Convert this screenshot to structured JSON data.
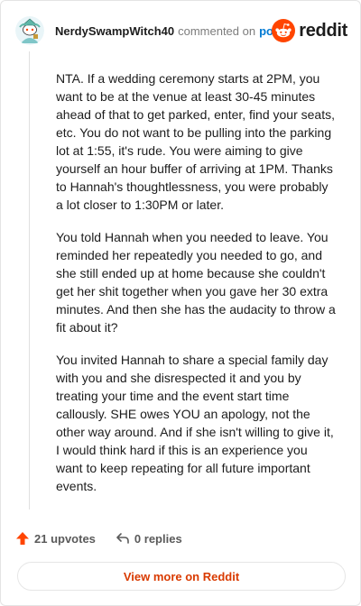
{
  "header": {
    "username": "NerdySwampWitch40",
    "action_text": "commented on",
    "post_link": "post",
    "brand": "reddit"
  },
  "comment": {
    "paragraphs": [
      "NTA. If a wedding ceremony starts at 2PM, you want to be at the venue at least 30-45 minutes ahead of that to get parked, enter, find your seats, etc. You do not want to be pulling into the parking lot at 1:55, it's rude. You were aiming to give yourself an hour buffer of arriving at 1PM. Thanks to Hannah's thoughtlessness, you were probably a lot closer to 1:30PM or later.",
      "You told Hannah when you needed to leave. You reminded her repeatedly you needed to go, and she still ended up at home because she couldn't get her shit together when you gave her 30 extra minutes. And then she has the audacity to throw a fit about it?",
      "You invited Hannah to share a special family day with you and she disrespected it and you by treating your time and the event start time callously. SHE owes YOU an apology, not the other way around. And if she isn't willing to give it, I would think hard if this is an experience you want to keep repeating for all future important events."
    ]
  },
  "actions": {
    "upvotes": "21 upvotes",
    "replies": "0 replies"
  },
  "footer": {
    "view_more": "View more on Reddit"
  },
  "colors": {
    "accent": "#ff4500",
    "link": "#0079d3",
    "view_more": "#d93a00"
  },
  "icons": {
    "avatar": "snoo-avatar-icon",
    "logo": "reddit-logo-icon",
    "upvote": "upvote-arrow-icon",
    "reply": "reply-arrow-icon"
  }
}
